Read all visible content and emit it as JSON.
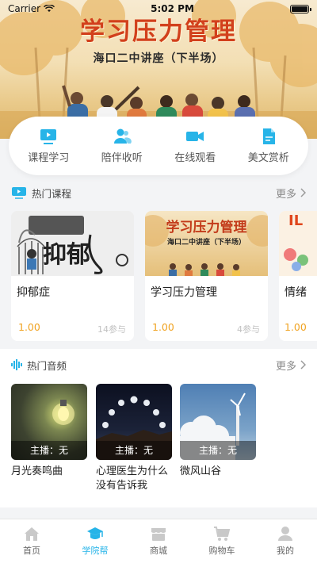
{
  "status_bar": {
    "carrier": "Carrier",
    "time": "5:02 PM"
  },
  "hero": {
    "title": "学习压力管理",
    "subtitle": "海口二中讲座（下半场）"
  },
  "categories": [
    {
      "label": "课程学习",
      "icon": "video-board-icon"
    },
    {
      "label": "陪伴收听",
      "icon": "people-icon"
    },
    {
      "label": "在线观看",
      "icon": "video-camera-icon"
    },
    {
      "label": "美文赏析",
      "icon": "document-icon"
    }
  ],
  "hot_courses": {
    "title": "热门课程",
    "more": "更多",
    "items": [
      {
        "title": "抑郁症",
        "price": "1.00",
        "participants": "14参与",
        "thumb_text": "抑郁"
      },
      {
        "title": "学习压力管理",
        "price": "1.00",
        "participants": "4参与",
        "thumb_title": "学习压力管理",
        "thumb_subtitle": "海口二中讲座（下半场）"
      },
      {
        "title": "情绪",
        "price": "1.00",
        "participants": "",
        "thumb_text": "IL"
      }
    ]
  },
  "hot_audio": {
    "title": "热门音频",
    "more": "更多",
    "items": [
      {
        "title": "月光奏鸣曲",
        "host": "主播：无"
      },
      {
        "title": "心理医生为什么没有告诉我",
        "host": "主播：无"
      },
      {
        "title": "微风山谷",
        "host": "主播：无"
      }
    ]
  },
  "colors": {
    "accent": "#27b4e8",
    "price": "#f0a321",
    "hero_title": "#d2401c"
  },
  "tabbar": {
    "items": [
      {
        "label": "首页",
        "icon": "home-icon",
        "active": false
      },
      {
        "label": "学院帮",
        "icon": "graduation-cap-icon",
        "active": true
      },
      {
        "label": "商城",
        "icon": "shop-icon",
        "active": false
      },
      {
        "label": "购物车",
        "icon": "cart-icon",
        "active": false
      },
      {
        "label": "我的",
        "icon": "user-icon",
        "active": false
      }
    ]
  }
}
